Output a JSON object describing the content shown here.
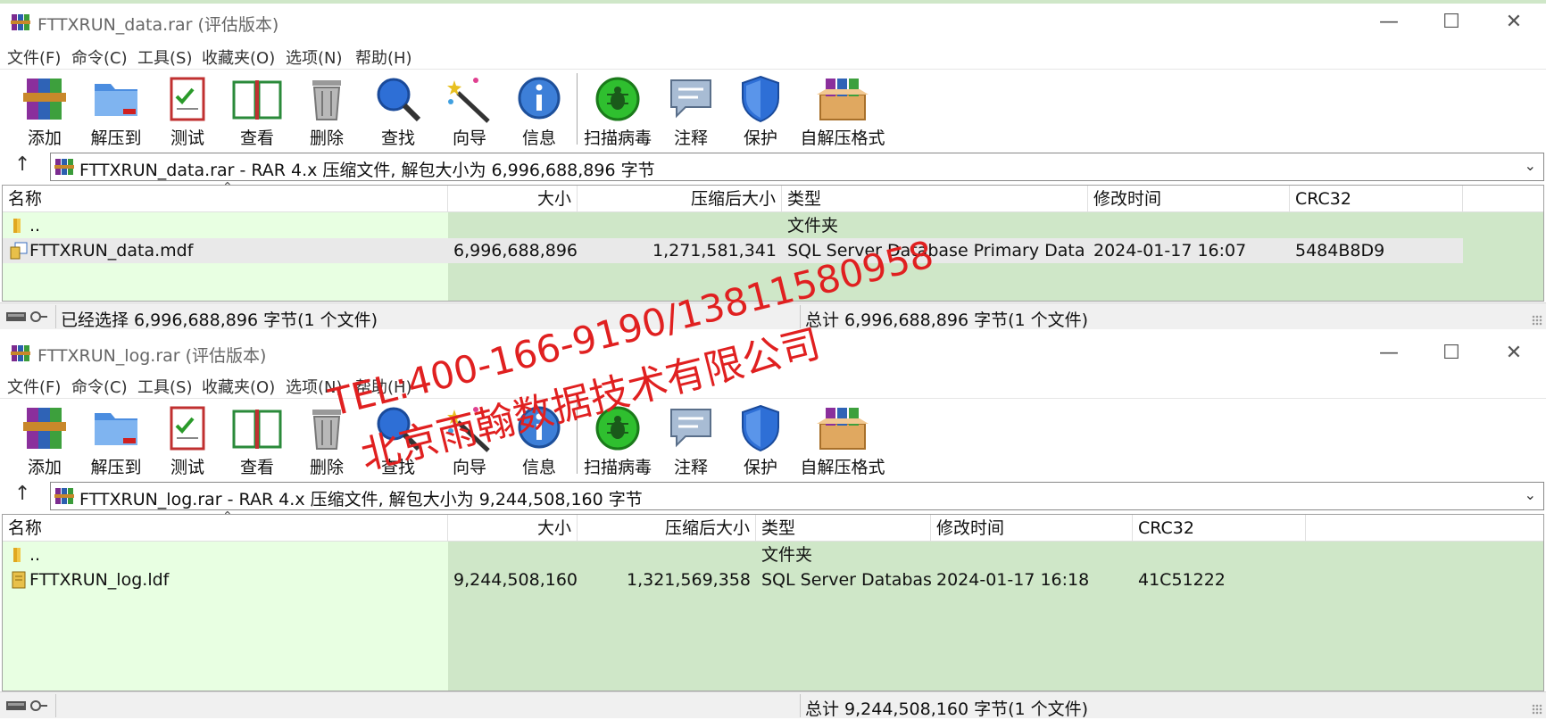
{
  "window1": {
    "title": "FTTXRUN_data.rar (评估版本)",
    "menu": [
      "文件(F)",
      "命令(C)",
      "工具(S)",
      "收藏夹(O)",
      "选项(N)",
      "帮助(H)"
    ],
    "toolbar": [
      "添加",
      "解压到",
      "测试",
      "查看",
      "删除",
      "查找",
      "向导",
      "信息",
      "扫描病毒",
      "注释",
      "保护",
      "自解压格式"
    ],
    "address": "FTTXRUN_data.rar - RAR 4.x 压缩文件, 解包大小为 6,996,688,896 字节",
    "columns": [
      "名称",
      "大小",
      "压缩后大小",
      "类型",
      "修改时间",
      "CRC32"
    ],
    "rows": [
      {
        "name": "..",
        "size": "",
        "packed": "",
        "type": "文件夹",
        "modified": "",
        "crc": ""
      },
      {
        "name": "FTTXRUN_data.mdf",
        "size": "6,996,688,896",
        "packed": "1,271,581,341",
        "type": "SQL Server Database Primary Data File",
        "modified": "2024-01-17 16:07",
        "crc": "5484B8D9"
      }
    ],
    "status_left": "已经选择 6,996,688,896 字节(1 个文件)",
    "status_right": "总计 6,996,688,896 字节(1 个文件)"
  },
  "window2": {
    "title": "FTTXRUN_log.rar (评估版本)",
    "menu": [
      "文件(F)",
      "命令(C)",
      "工具(S)",
      "收藏夹(O)",
      "选项(N)",
      "帮助(H)"
    ],
    "toolbar": [
      "添加",
      "解压到",
      "测试",
      "查看",
      "删除",
      "查找",
      "向导",
      "信息",
      "扫描病毒",
      "注释",
      "保护",
      "自解压格式"
    ],
    "address": "FTTXRUN_log.rar - RAR 4.x 压缩文件, 解包大小为 9,244,508,160 字节",
    "columns": [
      "名称",
      "大小",
      "压缩后大小",
      "类型",
      "修改时间",
      "CRC32"
    ],
    "rows": [
      {
        "name": "..",
        "size": "",
        "packed": "",
        "type": "文件夹",
        "modified": "",
        "crc": ""
      },
      {
        "name": "FTTXRUN_log.ldf",
        "size": "9,244,508,160",
        "packed": "1,321,569,358",
        "type": "SQL Server Databas...",
        "modified": "2024-01-17 16:18",
        "crc": "41C51222"
      }
    ],
    "status_left": "",
    "status_right": "总计 9,244,508,160 字节(1 个文件)"
  },
  "watermark": {
    "line1": "TEL:400-166-9190/13811580958",
    "line2": "北京雨翰数据技术有限公司"
  },
  "colors": {
    "list_bg": "#cfe7c8",
    "name_col_bg": "#e8ffe2",
    "watermark": "#e02020"
  }
}
